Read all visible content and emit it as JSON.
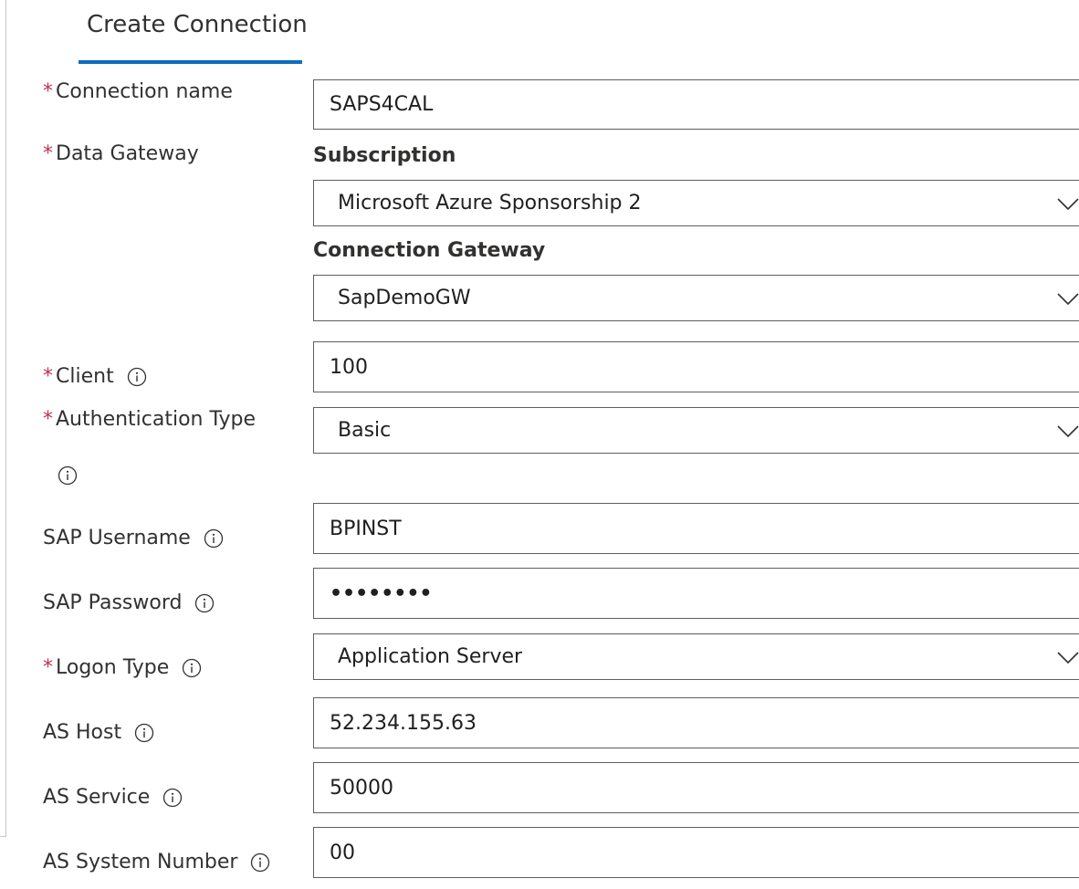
{
  "tab": {
    "label": "Create Connection"
  },
  "fields": {
    "connection_name": {
      "label": "Connection name",
      "required": true,
      "value": "SAPS4CAL"
    },
    "data_gateway": {
      "label": "Data Gateway",
      "required": true,
      "subscription_label": "Subscription",
      "subscription_value": "Microsoft Azure Sponsorship 2",
      "gateway_label": "Connection Gateway",
      "gateway_value": "SapDemoGW"
    },
    "client": {
      "label": "Client",
      "required": true,
      "value": "100"
    },
    "authentication_type": {
      "label": "Authentication Type",
      "required": true,
      "value": "Basic"
    },
    "sap_username": {
      "label": "SAP Username",
      "required": false,
      "value": "BPINST"
    },
    "sap_password": {
      "label": "SAP Password",
      "required": false,
      "value": "••••••••"
    },
    "logon_type": {
      "label": "Logon Type",
      "required": true,
      "value": "Application Server"
    },
    "as_host": {
      "label": "AS Host",
      "required": false,
      "value": "52.234.155.63"
    },
    "as_service": {
      "label": "AS Service",
      "required": false,
      "value": "50000"
    },
    "as_system_number": {
      "label": "AS System Number",
      "required": false,
      "value": "00"
    }
  },
  "required_marker": "*",
  "icons": {
    "info": "info-icon",
    "dropdown": "chevron-down-icon"
  },
  "colors": {
    "accent": "#0f6cbd",
    "required": "#c4314b",
    "border": "#605e5c",
    "text": "#323130"
  }
}
